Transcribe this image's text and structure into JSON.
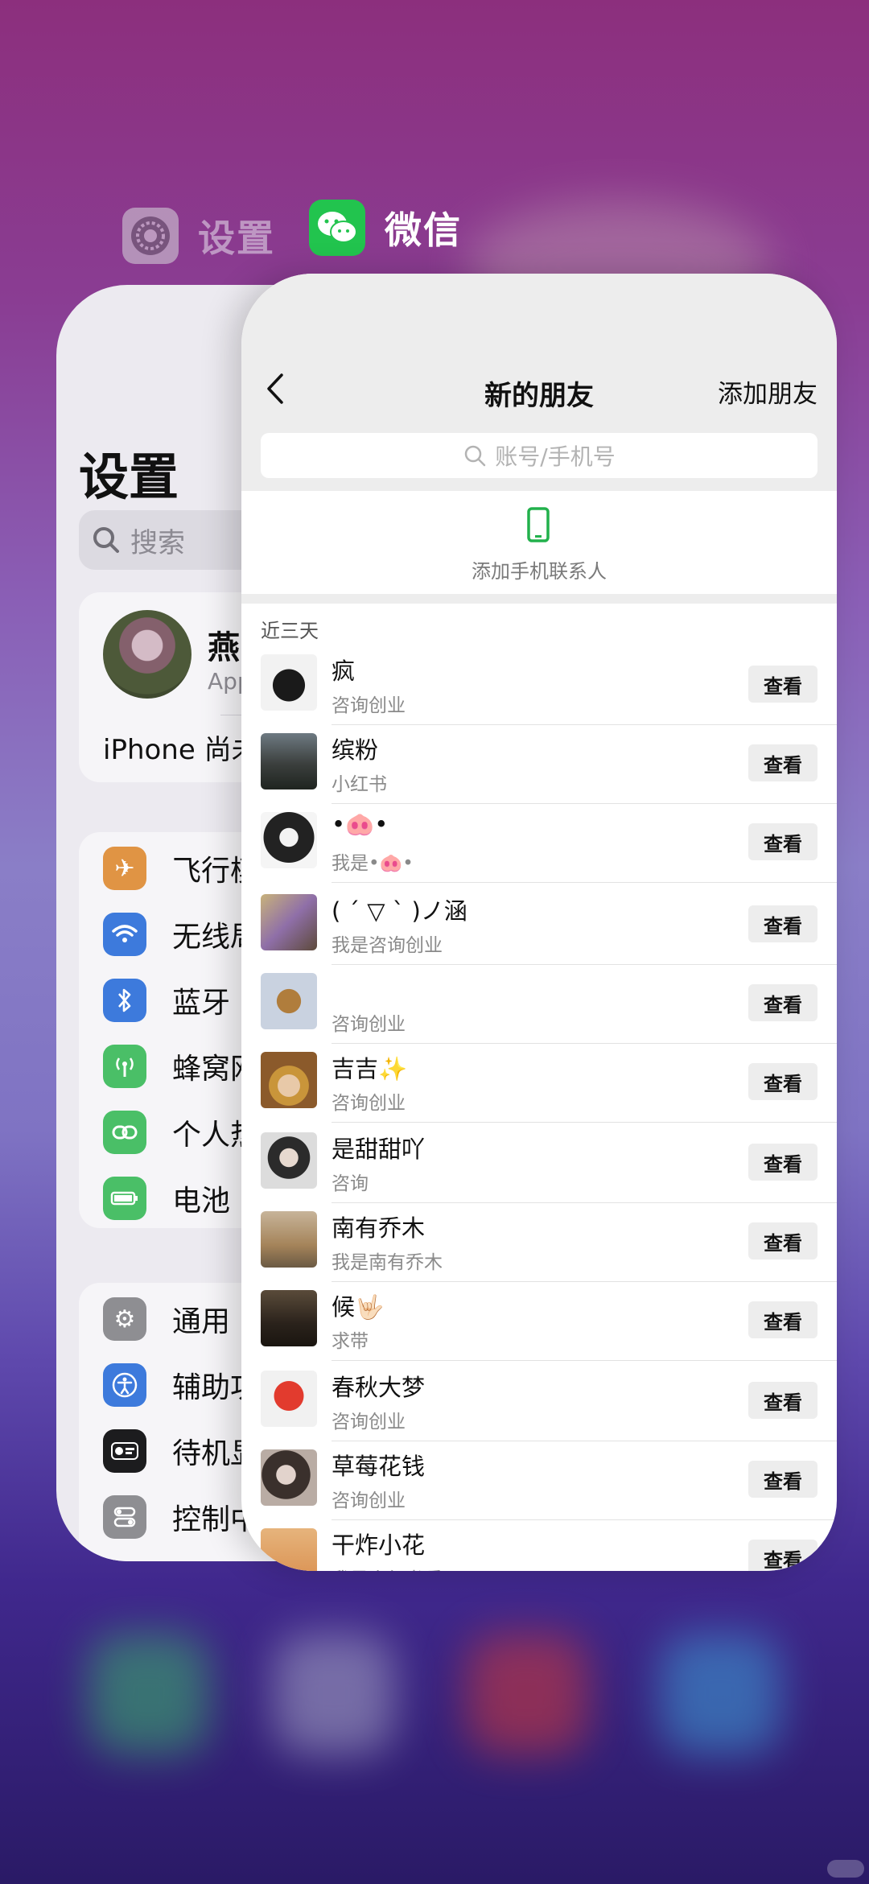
{
  "apps": {
    "settings_label": "设置",
    "wechat_label": "微信"
  },
  "settings": {
    "title": "设置",
    "search_placeholder": "搜索",
    "profile_name": "燕",
    "profile_sub": "App",
    "iphone_note": "iPhone 尚未",
    "rows_group1": [
      {
        "label": "飞行模",
        "icon": "airplane-icon",
        "color": "#f0912e"
      },
      {
        "label": "无线局",
        "icon": "wifi-icon",
        "color": "#2f7cf6"
      },
      {
        "label": "蓝牙",
        "icon": "bluetooth-icon",
        "color": "#2f7cf6"
      },
      {
        "label": "蜂窝网",
        "icon": "cellular-icon",
        "color": "#34c759"
      },
      {
        "label": "个人热",
        "icon": "hotspot-icon",
        "color": "#34c759"
      },
      {
        "label": "电池",
        "icon": "battery-icon",
        "color": "#34c759"
      }
    ],
    "rows_group2": [
      {
        "label": "通用",
        "icon": "gear-icon",
        "color": "#8e8e93"
      },
      {
        "label": "辅助功",
        "icon": "accessibility-icon",
        "color": "#2f7cf6"
      },
      {
        "label": "待机显",
        "icon": "standby-icon",
        "color": "#1c1c1e"
      },
      {
        "label": "控制中",
        "icon": "control-center-icon",
        "color": "#8e8e93"
      }
    ]
  },
  "wechat": {
    "title": "新的朋友",
    "add_friend": "添加朋友",
    "search_placeholder": "账号/手机号",
    "add_contacts": "添加手机联系人",
    "section_header": "近三天",
    "view_label": "查看",
    "friends": [
      {
        "name": "疯",
        "sub": "咨询创业"
      },
      {
        "name": "缤粉",
        "sub": "小红书"
      },
      {
        "name": "•🐽•",
        "sub": "我是•🐽•"
      },
      {
        "name": "( ´ ▽ ` )ノ涵",
        "sub": "我是咨询创业"
      },
      {
        "name": "",
        "sub": "咨询创业"
      },
      {
        "name": "吉吉✨",
        "sub": "咨询创业"
      },
      {
        "name": "是甜甜吖",
        "sub": "咨询"
      },
      {
        "name": "南有乔木",
        "sub": "我是南有乔木"
      },
      {
        "name": "候🤟🏻",
        "sub": "求带"
      },
      {
        "name": "春秋大梦",
        "sub": "咨询创业"
      },
      {
        "name": "草莓花钱",
        "sub": "咨询创业"
      },
      {
        "name": "干炸小花",
        "sub": "我是小红书看"
      }
    ]
  }
}
